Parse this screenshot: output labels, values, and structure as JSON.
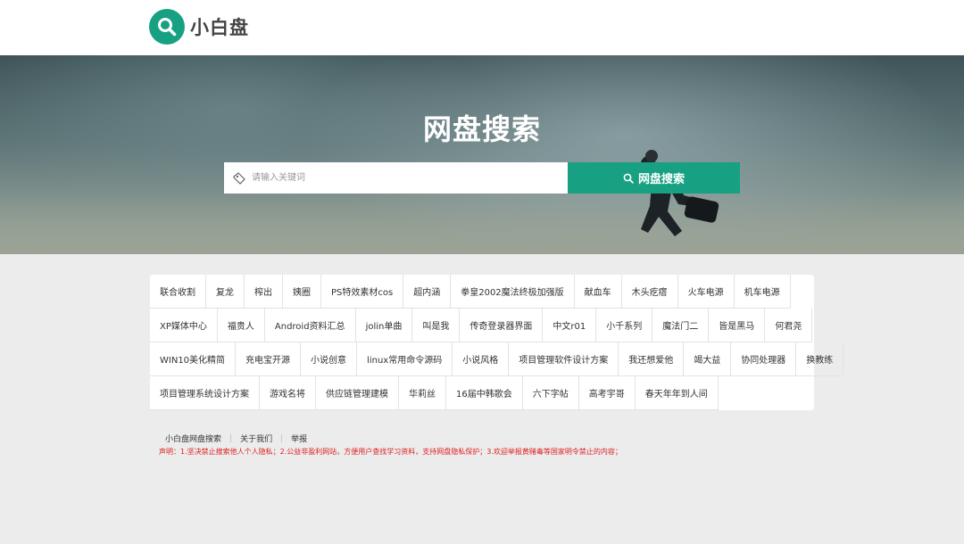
{
  "colors": {
    "accent": "#17a082",
    "notice": "#e02020"
  },
  "header": {
    "logo_text": "小白盘",
    "logo_icon": "search-icon"
  },
  "hero": {
    "title": "网盘搜索",
    "search": {
      "placeholder": "请输入关键词",
      "value": ""
    },
    "search_button_label": "网盘搜索"
  },
  "tags": [
    [
      "联合收割",
      "复龙",
      "榨出",
      "姨圈",
      "PS特效素材cos",
      "超内涵",
      "拳皇2002魔法终极加强版",
      "献血车",
      "木头疙瘩",
      "火车电源",
      "机车电源"
    ],
    [
      "XP媒体中心",
      "福贵人",
      "Android资料汇总",
      "jolin单曲",
      "叫是我",
      "传奇登录器界面",
      "中文r01",
      "小千系列",
      "魔法门二",
      "皆是黑马",
      "何君尧"
    ],
    [
      "WIN10美化精简",
      "充电宝开源",
      "小说创意",
      "linux常用命令源码",
      "小说风格",
      "项目管理软件设计方案",
      "我还想爱他",
      "竭大益",
      "协同处理器",
      "换教练"
    ],
    [
      "项目管理系统设计方案",
      "游戏名将",
      "供应链管理建模",
      "华莉丝",
      "16届中韩歌会",
      "六下字帖",
      "高考宇哥",
      "春天年年到人间"
    ]
  ],
  "footer": {
    "links": [
      "小白盘网盘搜索",
      "关于我们",
      "举报"
    ],
    "notice": "声明：1.坚决禁止搜索他人个人隐私；2.公益非盈利网站，方便用户查找学习资料，支持网盘隐私保护；3.欢迎举报黄赌毒等国家明令禁止的内容；"
  }
}
